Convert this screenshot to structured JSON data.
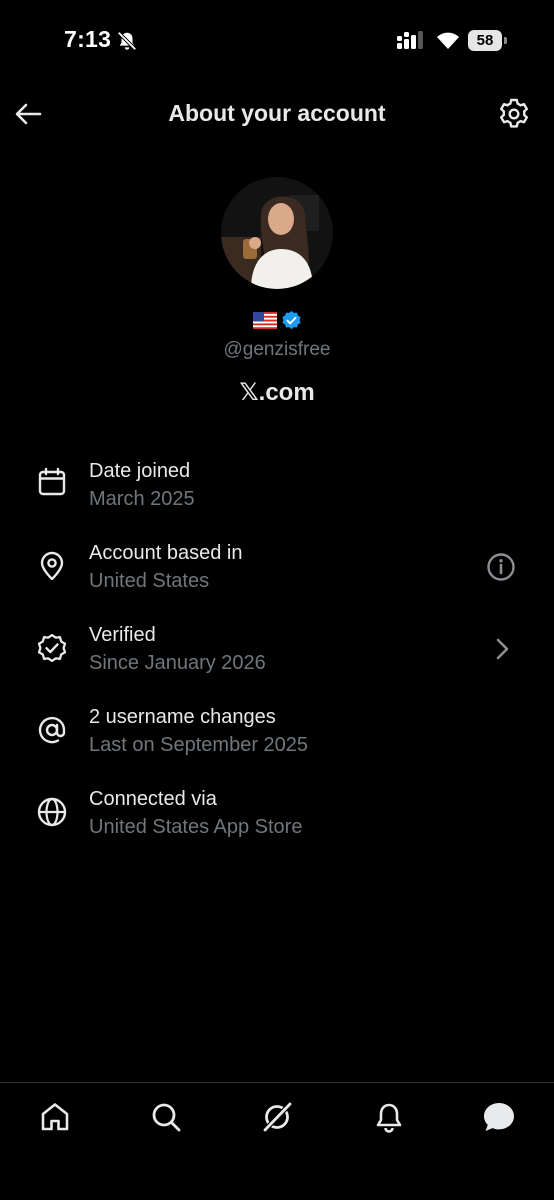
{
  "status_bar": {
    "time": "7:13",
    "battery": "58",
    "icons": [
      "bell-off-icon",
      "signal-icon",
      "wifi-icon",
      "battery-icon"
    ]
  },
  "header": {
    "title": "About your account",
    "back_icon": "arrow-left-icon",
    "settings_icon": "gear-icon"
  },
  "profile": {
    "flag": "🇺🇸",
    "handle": "@genzisfree",
    "site": "𝕏.com",
    "verified_color": "#1d9bf0"
  },
  "rows": [
    {
      "icon": "calendar-icon",
      "label": "Date joined",
      "sub": "March 2025",
      "action": ""
    },
    {
      "icon": "location-pin-icon",
      "label": "Account based in",
      "sub": "United States",
      "action": "info-icon"
    },
    {
      "icon": "verified-badge-icon",
      "label": "Verified",
      "sub": "Since January 2026",
      "action": "chevron-right-icon"
    },
    {
      "icon": "at-sign-icon",
      "label": "2 username changes",
      "sub": "Last on September 2025",
      "action": ""
    },
    {
      "icon": "globe-icon",
      "label": "Connected via",
      "sub": "United States App Store",
      "action": ""
    }
  ],
  "bottom_nav": {
    "items": [
      "home-icon",
      "search-icon",
      "grok-icon",
      "notifications-icon",
      "messages-icon"
    ]
  },
  "colors": {
    "background": "#000000",
    "primary_text": "#e7e9ea",
    "secondary_text": "#71767b",
    "accent": "#1d9bf0",
    "divider": "#2f3336"
  }
}
